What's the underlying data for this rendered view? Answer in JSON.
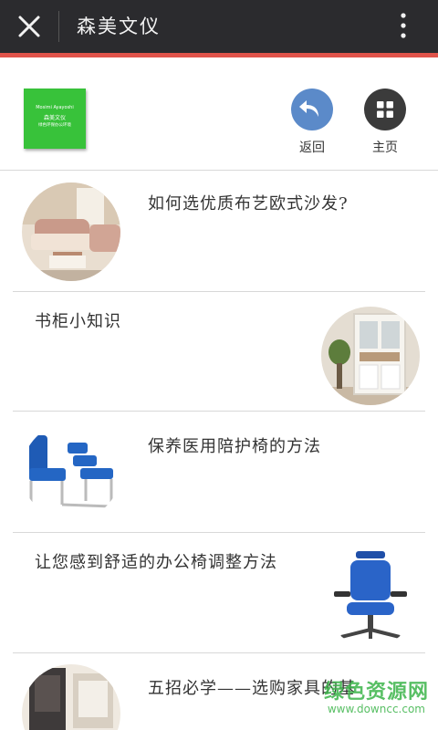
{
  "app": {
    "title": "森美文仪"
  },
  "logo": {
    "line1": "Mosimi Ayayoshi",
    "line2": "森美文仪",
    "line3": "绿色环保办公环境"
  },
  "nav": {
    "back_label": "返回",
    "home_label": "主页"
  },
  "articles": [
    {
      "title": "如何选优质布艺欧式沙发?",
      "image": "sofa"
    },
    {
      "title": "书柜小知识",
      "image": "bookcase"
    },
    {
      "title": "保养医用陪护椅的方法",
      "image": "medical-chair"
    },
    {
      "title": "让您感到舒适的办公椅调整方法",
      "image": "office-chair"
    },
    {
      "title": "五招必学——选购家具的基",
      "image": "furniture"
    }
  ],
  "watermark": {
    "cn": "绿色资源网",
    "url": "www.downcc.com"
  },
  "colors": {
    "topbar": "#2b2b2e",
    "accent_line": "#e0534a",
    "back_button": "#5b8ac9",
    "home_button": "#3b3b3b",
    "logo_green": "#38c23a",
    "watermark_green": "#3cb44a"
  }
}
